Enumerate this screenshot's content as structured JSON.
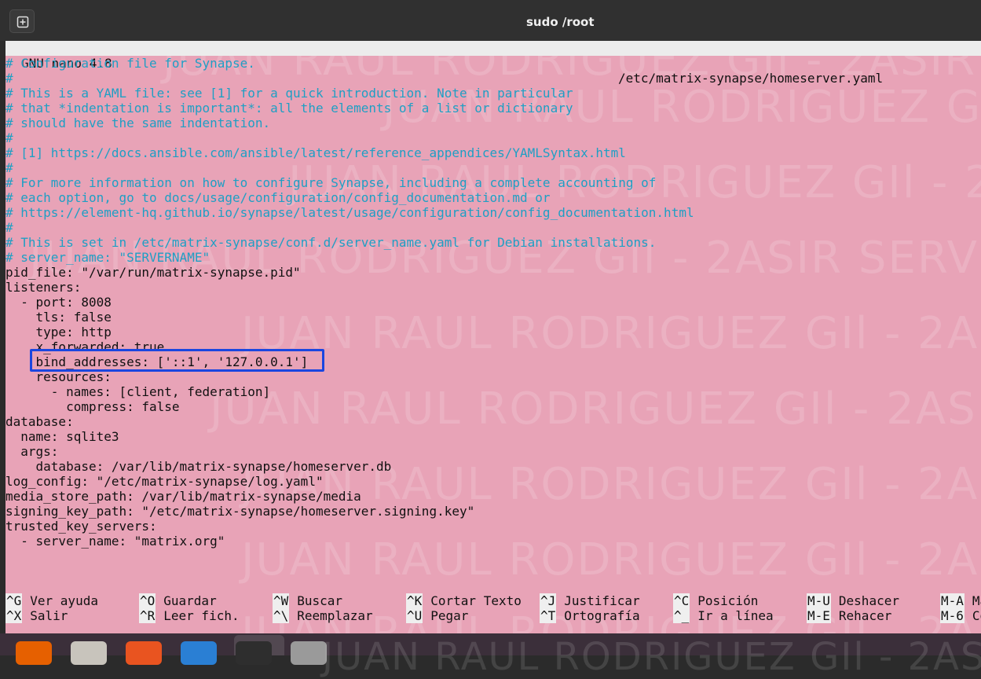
{
  "window": {
    "title": "sudo /root"
  },
  "nano": {
    "app": "GNU nano 4.8",
    "file": "/etc/matrix-synapse/homeserver.yaml"
  },
  "watermark": "JUAN RAUL RODRIGUEZ GIl - 2ASIR SERVER",
  "lines": [
    {
      "text": "# Configuration file for Synapse.",
      "comment": true
    },
    {
      "text": "#",
      "comment": true
    },
    {
      "text": "# This is a YAML file: see [1] for a quick introduction. Note in particular",
      "comment": true
    },
    {
      "text": "# that *indentation is important*: all the elements of a list or dictionary",
      "comment": true
    },
    {
      "text": "# should have the same indentation.",
      "comment": true
    },
    {
      "text": "#",
      "comment": true
    },
    {
      "text": "# [1] https://docs.ansible.com/ansible/latest/reference_appendices/YAMLSyntax.html",
      "comment": true
    },
    {
      "text": "#",
      "comment": true
    },
    {
      "text": "# For more information on how to configure Synapse, including a complete accounting of",
      "comment": true
    },
    {
      "text": "# each option, go to docs/usage/configuration/config_documentation.md or",
      "comment": true
    },
    {
      "text": "# https://element-hq.github.io/synapse/latest/usage/configuration/config_documentation.html",
      "comment": true
    },
    {
      "text": "#",
      "comment": true
    },
    {
      "text": "# This is set in /etc/matrix-synapse/conf.d/server_name.yaml for Debian installations.",
      "comment": true
    },
    {
      "text": "# server_name: \"SERVERNAME\"",
      "comment": true
    },
    {
      "text": "pid_file: \"/var/run/matrix-synapse.pid\"",
      "comment": false
    },
    {
      "text": "listeners:",
      "comment": false
    },
    {
      "text": "  - port: 8008",
      "comment": false
    },
    {
      "text": "    tls: false",
      "comment": false
    },
    {
      "text": "    type: http",
      "comment": false
    },
    {
      "text": "    x_forwarded: true",
      "comment": false
    },
    {
      "text": "    bind_addresses: ['::1', '127.0.0.1']",
      "comment": false
    },
    {
      "text": "    resources:",
      "comment": false
    },
    {
      "text": "      - names: [client, federation]",
      "comment": false
    },
    {
      "text": "        compress: false",
      "comment": false
    },
    {
      "text": "database:",
      "comment": false
    },
    {
      "text": "  name: sqlite3",
      "comment": false
    },
    {
      "text": "  args:",
      "comment": false
    },
    {
      "text": "    database: /var/lib/matrix-synapse/homeserver.db",
      "comment": false
    },
    {
      "text": "log_config: \"/etc/matrix-synapse/log.yaml\"",
      "comment": false
    },
    {
      "text": "media_store_path: /var/lib/matrix-synapse/media",
      "comment": false
    },
    {
      "text": "signing_key_path: \"/etc/matrix-synapse/homeserver.signing.key\"",
      "comment": false
    },
    {
      "text": "trusted_key_servers:",
      "comment": false
    },
    {
      "text": "  - server_name: \"matrix.org\"",
      "comment": false
    }
  ],
  "shortcuts": [
    {
      "key": "^G",
      "label": "Ver ayuda"
    },
    {
      "key": "^X",
      "label": "Salir"
    },
    {
      "key": "^O",
      "label": "Guardar"
    },
    {
      "key": "^R",
      "label": "Leer fich."
    },
    {
      "key": "^W",
      "label": "Buscar"
    },
    {
      "key": "^\\",
      "label": "Reemplazar"
    },
    {
      "key": "^K",
      "label": "Cortar Texto"
    },
    {
      "key": "^U",
      "label": "Pegar"
    },
    {
      "key": "^J",
      "label": "Justificar"
    },
    {
      "key": "^T",
      "label": "Ortografía"
    },
    {
      "key": "^C",
      "label": "Posición"
    },
    {
      "key": "^_",
      "label": "Ir a línea"
    },
    {
      "key": "M-U",
      "label": "Deshacer"
    },
    {
      "key": "M-E",
      "label": "Rehacer"
    },
    {
      "key": "M-A",
      "label": "Ma"
    },
    {
      "key": "M-6",
      "label": "Co"
    }
  ],
  "dock": [
    {
      "icon": "firefox-icon",
      "color": "#e66000"
    },
    {
      "icon": "files-icon",
      "color": "#c8c4bc"
    },
    {
      "icon": "software-store-icon",
      "color": "#e95420"
    },
    {
      "icon": "help-icon",
      "color": "#2a7fd4"
    },
    {
      "icon": "terminal-icon",
      "color": "#2e2e2e"
    },
    {
      "icon": "settings-icon",
      "color": "#9a9a9a"
    }
  ]
}
